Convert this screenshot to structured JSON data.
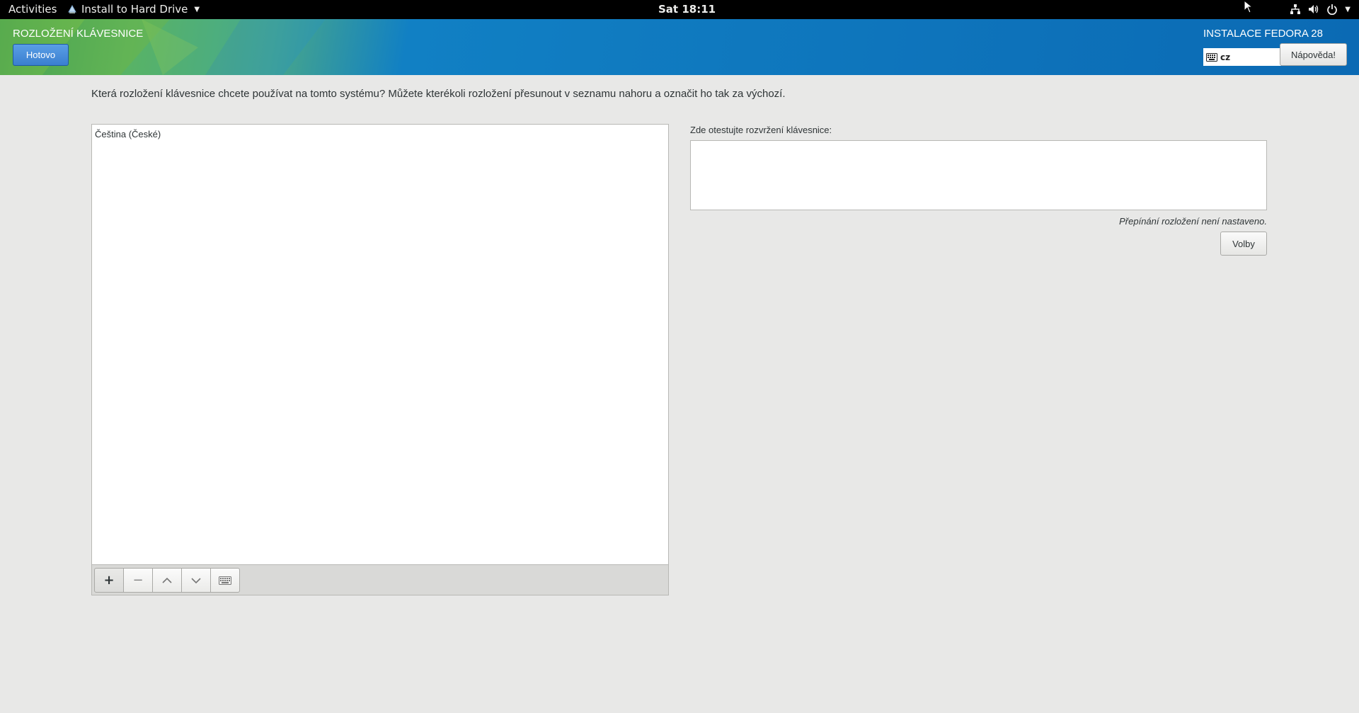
{
  "topbar": {
    "activities": "Activities",
    "app_name": "Install to Hard Drive",
    "clock": "Sat 18:11"
  },
  "header": {
    "spoke_title": "ROZLOŽENÍ KLÁVESNICE",
    "done_label": "Hotovo",
    "product_title": "INSTALACE FEDORA 28",
    "keyboard_indicator": "cz",
    "help_label": "Nápověda!"
  },
  "main": {
    "question": "Která rozložení klávesnice chcete používat na tomto systému?  Můžete kterékoli rozložení přesunout v seznamu nahoru a označit ho tak za výchozí.",
    "layouts": [
      "Čeština (České)"
    ],
    "test_label": "Zde otestujte rozvržení klávesnice:",
    "test_value": "",
    "switch_note": "Přepínání rozložení není nastaveno.",
    "options_label": "Volby",
    "toolbar": {
      "add_label": "+",
      "remove_label": "−"
    }
  },
  "icons": [
    "keyboard-icon",
    "network-icon",
    "volume-icon",
    "power-icon",
    "chevron-up-icon",
    "chevron-down-icon"
  ],
  "colors": {
    "header_blue": "#0b6ab4",
    "header_green": "#67b64a",
    "done_button": "#3a7fcf",
    "background": "#e8e8e7"
  }
}
